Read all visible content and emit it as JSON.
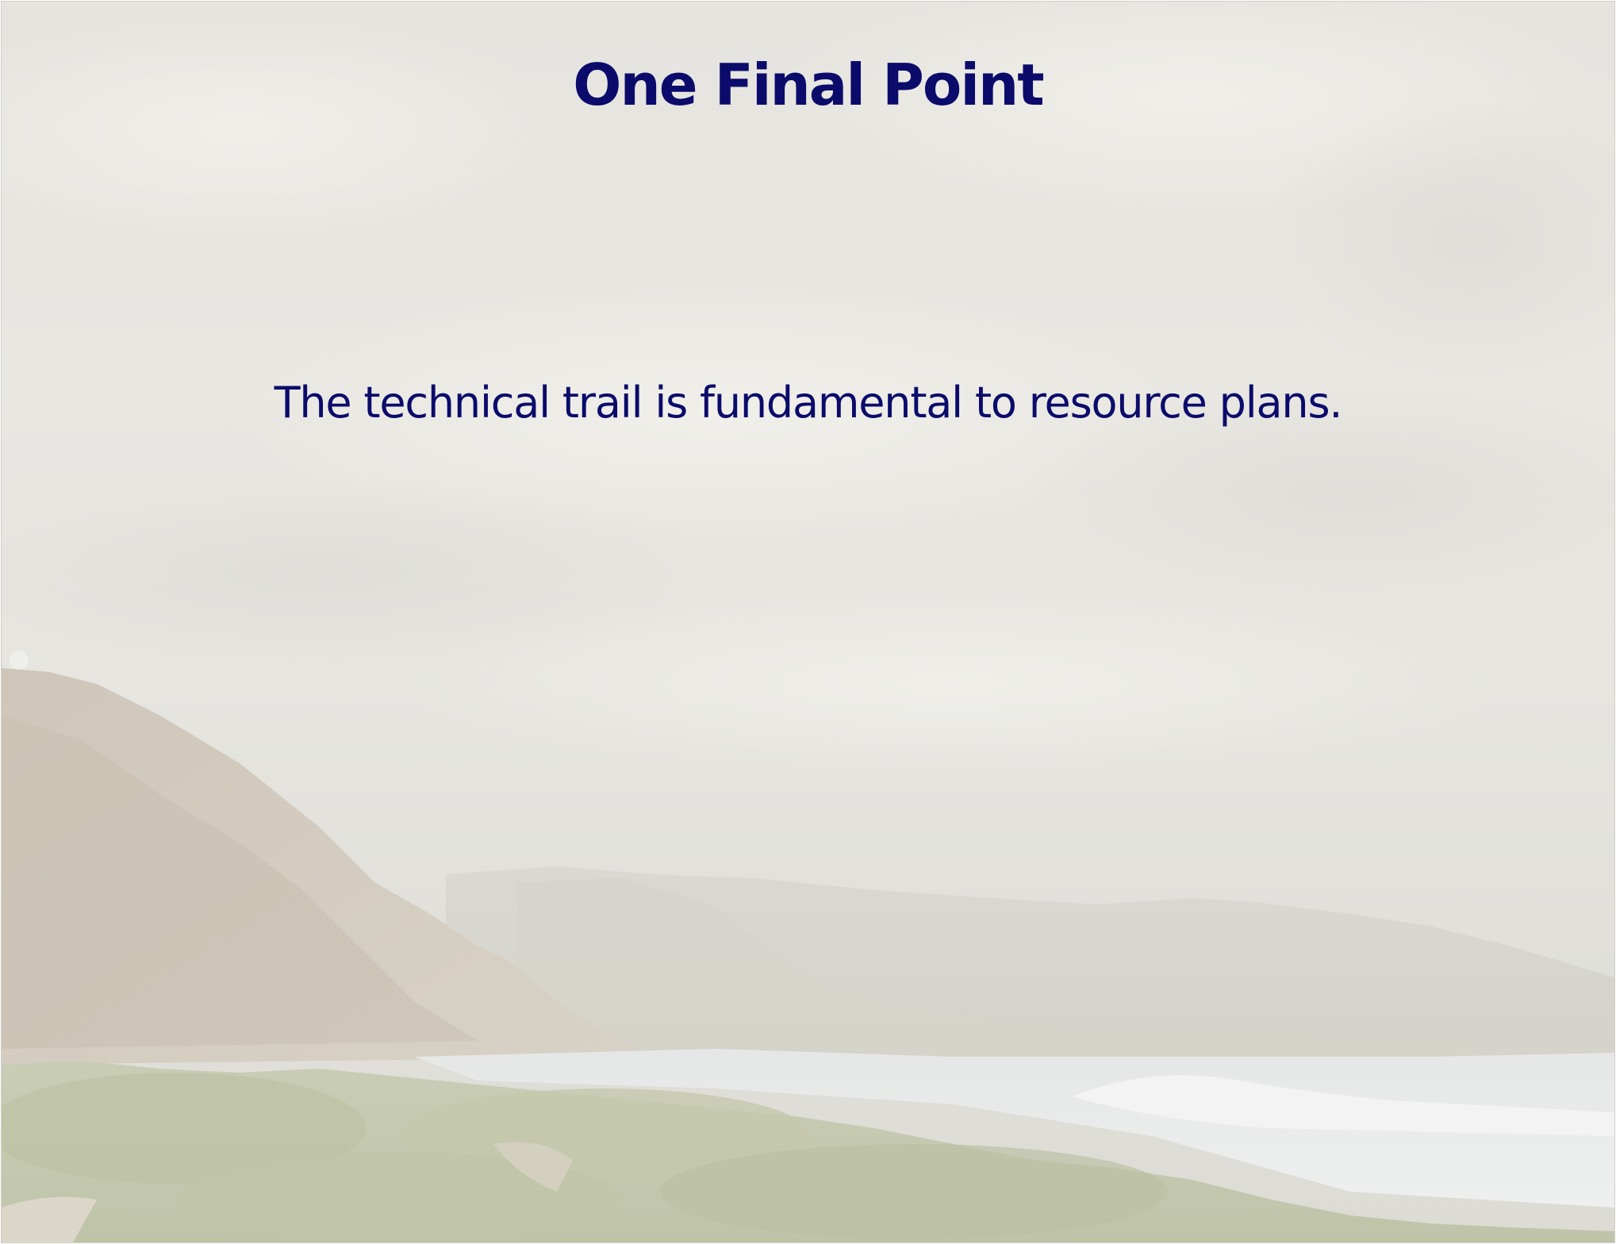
{
  "slide": {
    "title": "One Final Point",
    "body": "The technical trail is fundamental to resource plans.",
    "text_color": "#0b0b6b",
    "background": "faded coastal landscape photo with overcast sky, hills on the left and sea on the right"
  }
}
